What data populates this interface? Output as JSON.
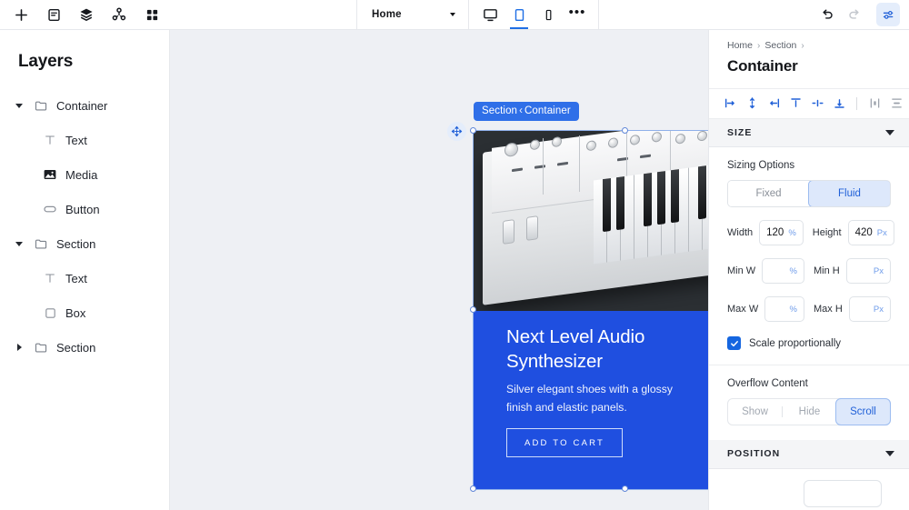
{
  "toolbar": {
    "left_icons": [
      {
        "name": "add-icon",
        "label": "Add"
      },
      {
        "name": "pages-icon",
        "label": "Pages"
      },
      {
        "name": "layers-icon",
        "label": "Layers"
      },
      {
        "name": "components-icon",
        "label": "Components"
      },
      {
        "name": "assets-icon",
        "label": "Assets"
      }
    ],
    "page_label": "Home",
    "devices": [
      {
        "name": "desktop",
        "active": false
      },
      {
        "name": "tablet",
        "active": true
      },
      {
        "name": "mobile",
        "active": false
      }
    ],
    "more_label": "•••",
    "undo_label": "Undo",
    "redo_label": "Redo",
    "panel_toggle_label": "Settings"
  },
  "layers": {
    "title": "Layers",
    "items": [
      {
        "label": "Container",
        "icon": "folder-icon",
        "depth": 0,
        "expanded": true
      },
      {
        "label": "Text",
        "icon": "text-icon",
        "depth": 1,
        "expanded": null
      },
      {
        "label": "Media",
        "icon": "media-icon",
        "depth": 1,
        "expanded": null
      },
      {
        "label": "Button",
        "icon": "button-icon",
        "depth": 1,
        "expanded": null
      },
      {
        "label": "Section",
        "icon": "folder-icon",
        "depth": 0,
        "expanded": true
      },
      {
        "label": "Text",
        "icon": "text-icon",
        "depth": 1,
        "expanded": null
      },
      {
        "label": "Box",
        "icon": "box-icon",
        "depth": 1,
        "expanded": null
      },
      {
        "label": "Section",
        "icon": "folder-icon",
        "depth": 0,
        "expanded": false
      }
    ]
  },
  "canvas": {
    "selection_badge": {
      "parent": "Section",
      "separator": "‹",
      "current": "Container"
    },
    "card": {
      "title": "Next Level Audio Synthesizer",
      "description": "Silver elegant shoes with a glossy finish and elastic panels.",
      "cta_label": "ADD TO CART",
      "badge_icon": "audio-waveform-icon",
      "background_color": "#1f4fe0"
    },
    "image_alt": "white analog synthesizer keyboard on dark background",
    "background_color": "#eef0f4"
  },
  "inspector": {
    "breadcrumb": [
      {
        "label": "Home"
      },
      {
        "label": "Section"
      }
    ],
    "breadcrumb_separator": "›",
    "title": "Container",
    "align_tools": [
      {
        "name": "align-left-icon",
        "color": "#2161d8"
      },
      {
        "name": "align-center-horizontal-icon",
        "color": "#2161d8"
      },
      {
        "name": "align-right-icon",
        "color": "#2161d8"
      },
      {
        "name": "align-top-icon",
        "color": "#2161d8"
      },
      {
        "name": "align-middle-vertical-icon",
        "color": "#2161d8"
      },
      {
        "name": "align-bottom-icon",
        "color": "#2161d8"
      },
      {
        "name": "distribute-horizontal-icon",
        "color": "#9aa0aa"
      },
      {
        "name": "distribute-vertical-icon",
        "color": "#9aa0aa"
      }
    ],
    "size": {
      "section_title": "SIZE",
      "sizing_options_label": "Sizing Options",
      "sizing_modes": [
        {
          "label": "Fixed",
          "active": false
        },
        {
          "label": "Fluid",
          "active": true
        }
      ],
      "fields": [
        {
          "label": "Width",
          "value": "120",
          "unit": "%"
        },
        {
          "label": "Height",
          "value": "420",
          "unit": "Px"
        },
        {
          "label": "Min W",
          "value": "",
          "unit": "%"
        },
        {
          "label": "Min H",
          "value": "",
          "unit": "Px"
        },
        {
          "label": "Max W",
          "value": "",
          "unit": "%"
        },
        {
          "label": "Max H",
          "value": "",
          "unit": "Px"
        }
      ],
      "scale_proportionally_label": "Scale proportionally",
      "scale_proportionally_checked": true
    },
    "overflow": {
      "label": "Overflow Content",
      "options": [
        {
          "label": "Show",
          "active": false
        },
        {
          "label": "Hide",
          "active": false
        },
        {
          "label": "Scroll",
          "active": true
        }
      ]
    },
    "position": {
      "section_title": "POSITION"
    }
  }
}
